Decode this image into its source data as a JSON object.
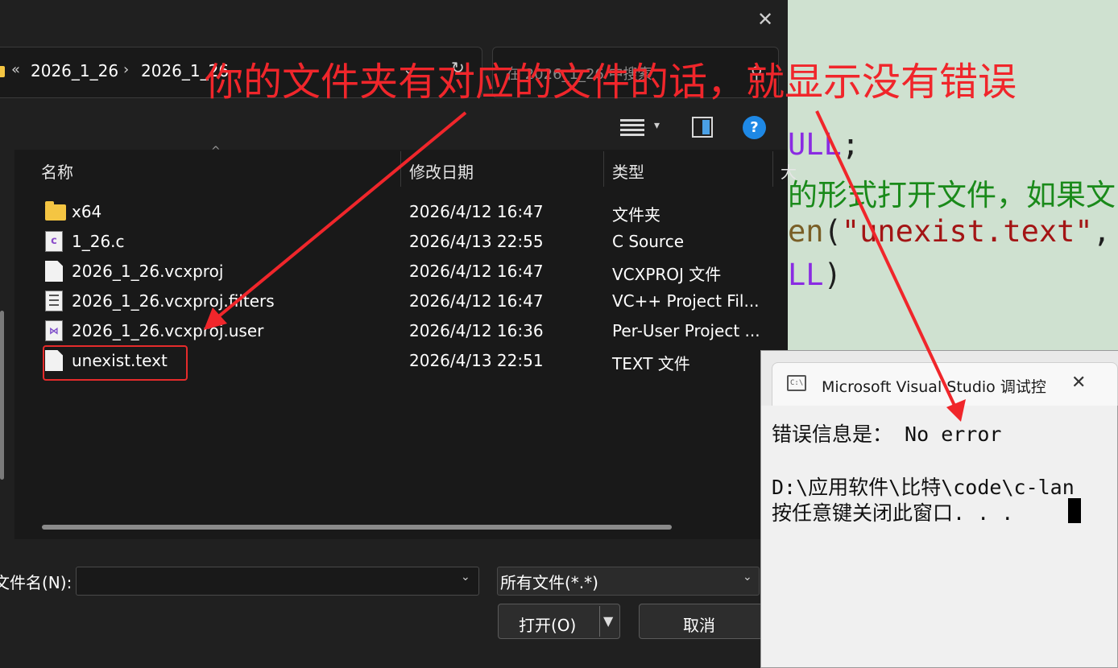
{
  "annotation": "你的文件夹有对应的文件的话，就显示没有错误",
  "code": {
    "line1_kw": "ULL",
    "line1_rest": ";",
    "line2_comment": "的形式打开文件，如果文",
    "line3_fn": "en",
    "line3_open": "(",
    "line3_str": "\"unexist.text\"",
    "line3_rest": ",",
    "line4_kw": "LL",
    "line4_rest": ")"
  },
  "dialog": {
    "close_glyph": "✕",
    "breadcrumb": {
      "chevron": "«",
      "items": [
        "2026_1_26",
        "2026_1_26"
      ],
      "separator": "›"
    },
    "search_placeholder": "在 2026_1_26 中搜索",
    "columns": [
      "名称",
      "修改日期",
      "类型",
      "大"
    ],
    "files": [
      {
        "name": "x64",
        "date": "2026/4/12 16:47",
        "type": "文件夹",
        "icon": "folder-icon"
      },
      {
        "name": "1_26.c",
        "date": "2026/4/13 22:55",
        "type": "C Source",
        "icon": "c-source-file-icon"
      },
      {
        "name": "2026_1_26.vcxproj",
        "date": "2026/4/12 16:47",
        "type": "VCXPROJ 文件",
        "icon": "document-icon"
      },
      {
        "name": "2026_1_26.vcxproj.filters",
        "date": "2026/4/12 16:47",
        "type": "VC++ Project Fil...",
        "icon": "filters-file-icon"
      },
      {
        "name": "2026_1_26.vcxproj.user",
        "date": "2026/4/12 16:36",
        "type": "Per-User Project ...",
        "icon": "vs-project-file-icon"
      },
      {
        "name": "unexist.text",
        "date": "2026/4/13 22:51",
        "type": "TEXT 文件",
        "icon": "document-icon"
      }
    ],
    "filename_label": "文件名(N):",
    "filename_value": "",
    "filetype": "所有文件(*.*)",
    "open_button": "打开(O)",
    "cancel_button": "取消"
  },
  "console": {
    "title": "Microsoft Visual Studio 调试控",
    "close_glyph": "✕",
    "line1": "错误信息是： No error",
    "line2": "D:\\应用软件\\比特\\code\\c-lan",
    "line3": "按任意键关闭此窗口. . ."
  }
}
